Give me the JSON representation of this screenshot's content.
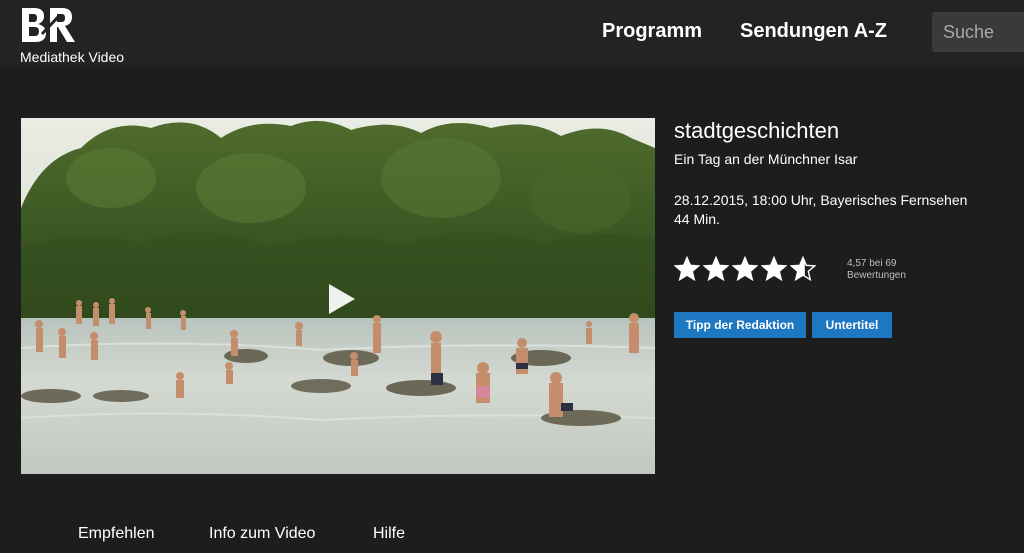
{
  "header": {
    "logo_text": "BR",
    "logo_sub": "Mediathek Video",
    "nav": [
      {
        "label": "Programm"
      },
      {
        "label": "Sendungen A-Z"
      }
    ],
    "search_placeholder": "Suche"
  },
  "video": {
    "title": "stadtgeschichten",
    "subtitle": "Ein Tag an der Münchner Isar",
    "broadcast": "28.12.2015, 18:00 Uhr, Bayerisches Fernsehen",
    "duration": "44 Min.",
    "rating": {
      "value": 4.57,
      "max": 5,
      "line1": "4,57 bei 69",
      "line2": "Bewertungen"
    },
    "tags": [
      {
        "label": "Tipp der Redaktion"
      },
      {
        "label": "Untertitel"
      }
    ]
  },
  "tabs": [
    {
      "label": "Empfehlen"
    },
    {
      "label": "Info zum Video"
    },
    {
      "label": "Hilfe"
    }
  ],
  "colors": {
    "background": "#1d1d1d",
    "header": "#232323",
    "accent": "#1d78c1"
  },
  "icons": {
    "play": "play-icon",
    "star": "star-icon",
    "logo": "br-logo"
  }
}
